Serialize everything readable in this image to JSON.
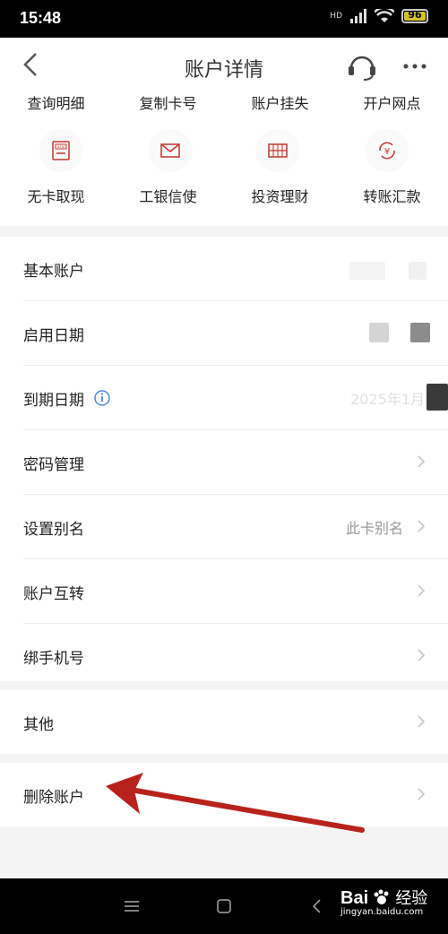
{
  "status": {
    "time": "15:48",
    "network": "HD",
    "battery": "96"
  },
  "header": {
    "title": "账户详情"
  },
  "top_row": [
    "查询明细",
    "复制卡号",
    "账户挂失",
    "开户网点"
  ],
  "services": [
    {
      "label": "无卡取现",
      "icon": "atm-icon"
    },
    {
      "label": "工银信使",
      "icon": "mail-icon"
    },
    {
      "label": "投资理财",
      "icon": "abacus-icon"
    },
    {
      "label": "转账汇款",
      "icon": "transfer-icon"
    }
  ],
  "account_section": [
    {
      "label": "基本账户",
      "value": ""
    },
    {
      "label": "启用日期",
      "value": ""
    },
    {
      "label": "到期日期",
      "value": "2025年1月"
    },
    {
      "label": "密码管理",
      "value": ""
    },
    {
      "label": "设置别名",
      "value": "此卡别名"
    },
    {
      "label": "账户互转",
      "value": ""
    },
    {
      "label": "绑手机号",
      "value": ""
    }
  ],
  "other": {
    "label": "其他"
  },
  "delete": {
    "label": "删除账户"
  },
  "watermark": {
    "brand": "Bai",
    "brand2": "经验",
    "url": "jingyan.baidu.com"
  }
}
